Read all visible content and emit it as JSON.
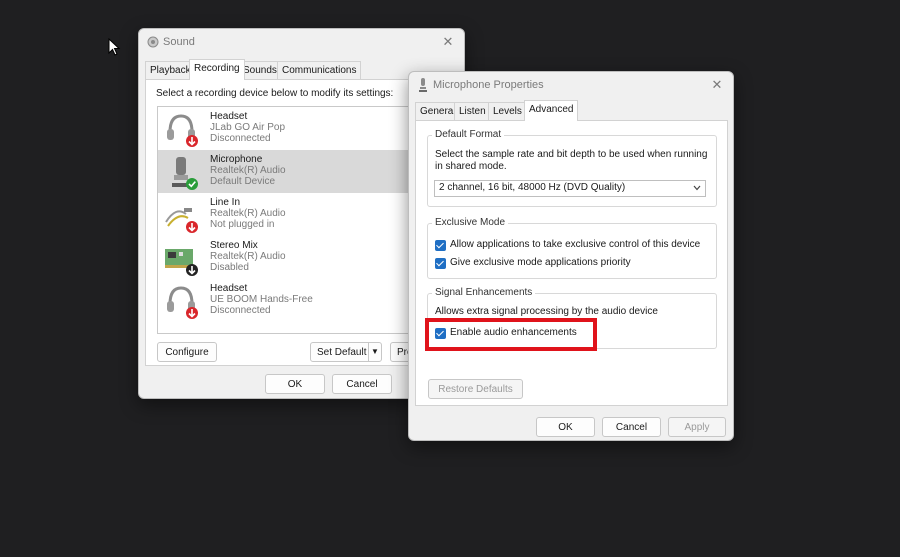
{
  "sound": {
    "title": "Sound",
    "tabs": [
      "Playback",
      "Recording",
      "Sounds",
      "Communications"
    ],
    "instruction": "Select a recording device below to modify its settings:",
    "devices": [
      {
        "name": "Headset",
        "detail": "JLab GO Air Pop",
        "status": "Disconnected",
        "icon": "headset-icon",
        "badge": "red-down-arrow"
      },
      {
        "name": "Microphone",
        "detail": "Realtek(R) Audio",
        "status": "Default Device",
        "icon": "microphone-icon",
        "badge": "green-check"
      },
      {
        "name": "Line In",
        "detail": "Realtek(R) Audio",
        "status": "Not plugged in",
        "icon": "line-in-cable-icon",
        "badge": "red-down-arrow"
      },
      {
        "name": "Stereo Mix",
        "detail": "Realtek(R) Audio",
        "status": "Disabled",
        "icon": "sound-card-icon",
        "badge": "black-down-arrow"
      },
      {
        "name": "Headset",
        "detail": "UE BOOM Hands-Free",
        "status": "Disconnected",
        "icon": "headset-icon",
        "badge": "red-down-arrow"
      }
    ],
    "buttons": {
      "configure": "Configure",
      "set_default": "Set Default",
      "properties": "Pro",
      "ok": "OK",
      "cancel": "Cancel"
    }
  },
  "mic_props": {
    "title": "Microphone Properties",
    "tabs": [
      "General",
      "Listen",
      "Levels",
      "Advanced"
    ],
    "default_format": {
      "title": "Default Format",
      "description": "Select the sample rate and bit depth to be used when running in shared mode.",
      "selected": "2 channel, 16 bit, 48000 Hz (DVD Quality)"
    },
    "exclusive_mode": {
      "title": "Exclusive Mode",
      "options": [
        {
          "label": "Allow applications to take exclusive control of this device",
          "checked": true
        },
        {
          "label": "Give exclusive mode applications priority",
          "checked": true
        }
      ]
    },
    "signal_enhancements": {
      "title": "Signal Enhancements",
      "description": "Allows extra signal processing by the audio device",
      "option": {
        "label": "Enable audio enhancements",
        "checked": true
      }
    },
    "buttons": {
      "restore_defaults": "Restore Defaults",
      "ok": "OK",
      "cancel": "Cancel",
      "apply": "Apply"
    }
  },
  "colors": {
    "highlight": "#e0131b",
    "checkbox": "#1f6fc4",
    "selection": "#d9d9d9"
  }
}
